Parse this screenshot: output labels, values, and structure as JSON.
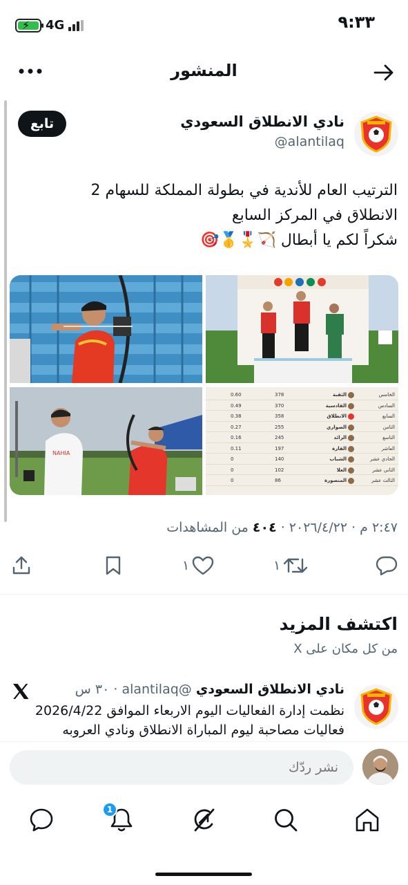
{
  "status_bar": {
    "time": "٩:٣٣",
    "network": "4G",
    "battery_color": "#2fbf4a"
  },
  "topbar": {
    "title": "المنشور",
    "more_icon": "more-horizontal-icon",
    "back_icon": "arrow-right-icon"
  },
  "tweet": {
    "author_name": "نادي الانطلاق السعودي",
    "author_handle": "@alantilaq",
    "follow_label": "تابع",
    "text_lines": [
      "الترتيب العام للأندية في بطولة المملكة للسهام 2",
      "الانطلاق في المركز السابع",
      "شكراً لكم يا أبطال 🏹🎖️🥇🎯"
    ],
    "timestamp": "٢:٤٧ م · ٢٠٢٦/٤/٢٢ · ",
    "views_count": "٤٠٤",
    "views_label": " من المشاهدات",
    "photos": [
      "archer-aiming-photo",
      "podium-photo",
      "archers-field-photo",
      "standings-table-photo"
    ],
    "standings": {
      "rows": [
        {
          "rank": "الخامس",
          "club": "الثقبة",
          "points": "378",
          "ratio": "0.60"
        },
        {
          "rank": "السادس",
          "club": "القادسية",
          "points": "370",
          "ratio": "0.49"
        },
        {
          "rank": "السابع",
          "club": "الانطلاق",
          "points": "358",
          "ratio": "0.38"
        },
        {
          "rank": "الثامن",
          "club": "الصواري",
          "points": "255",
          "ratio": "0.27"
        },
        {
          "rank": "التاسع",
          "club": "الرائد",
          "points": "245",
          "ratio": "0.16"
        },
        {
          "rank": "العاشر",
          "club": "القارة",
          "points": "197",
          "ratio": "0.11"
        },
        {
          "rank": "الحادي عشر",
          "club": "الشباب",
          "points": "140",
          "ratio": "0"
        },
        {
          "rank": "الثاني عشر",
          "club": "العلا",
          "points": "102",
          "ratio": "0"
        },
        {
          "rank": "الثالث عشر",
          "club": "المنصورة",
          "points": "86",
          "ratio": "0"
        }
      ]
    },
    "actions": {
      "share_icon": "share-icon",
      "bookmark_icon": "bookmark-icon",
      "like_count": "١",
      "like_icon": "heart-icon",
      "retweet_count": "١",
      "retweet_icon": "retweet-icon",
      "reply_icon": "reply-icon"
    }
  },
  "discover": {
    "title": "اكتشف المزيد",
    "subtitle": "من كل مكان على X",
    "card": {
      "author_name": "نادي الانطلاق السعودي",
      "author_handle": "@alantilaq",
      "time": "٣٠ س",
      "text_lines": [
        "نظمت إدارة الفعاليات اليوم الاربعاء الموافق 2026/4/22",
        "فعاليات مصاحبة ليوم المباراة الانطلاق ونادي العروبه"
      ]
    }
  },
  "reply": {
    "placeholder": "نشر ردّك"
  },
  "bottom_nav": {
    "items": [
      "home-icon",
      "search-icon",
      "grok-icon",
      "notifications-icon",
      "messages-icon"
    ],
    "notification_badge": "1"
  }
}
